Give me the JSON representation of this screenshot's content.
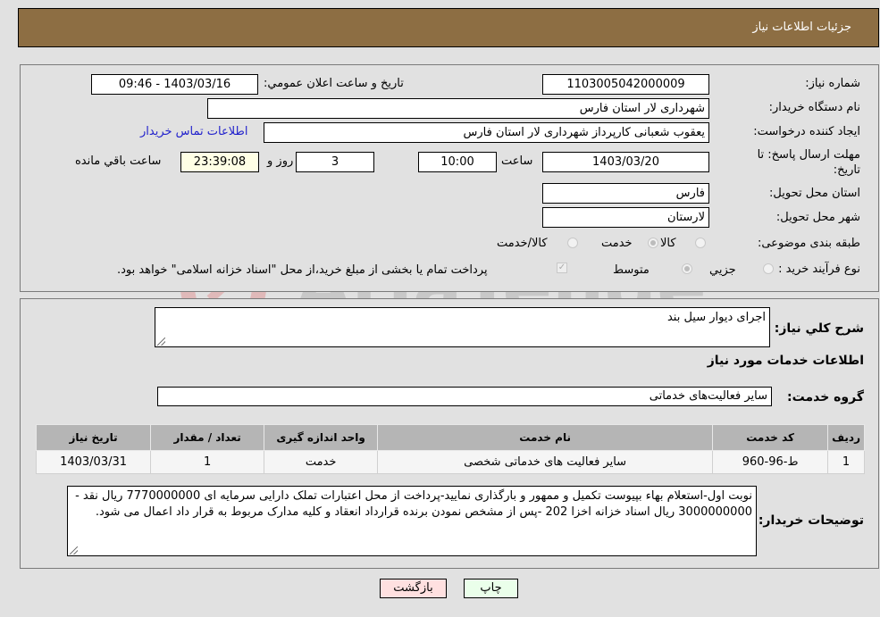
{
  "header": {
    "title": "جزئیات اطلاعات نیاز"
  },
  "form": {
    "need_number_label": "شماره نیاز:",
    "need_number": "1103005042000009",
    "announce_label": "تاریخ و ساعت اعلان عمومي:",
    "announce_value": "1403/03/16 - 09:46",
    "buyer_org_label": "نام دستگاه خریدار:",
    "buyer_org": "شهرداری لار استان فارس",
    "creator_label": "ایجاد کننده درخواست:",
    "creator": "یعقوب شعبانی کارپرداز شهرداری لار استان فارس",
    "contact_link": "اطلاعات تماس خریدار",
    "deadline_label": "مهلت ارسال پاسخ: تا تاریخ:",
    "deadline_date": "1403/03/20",
    "time_label": "ساعت",
    "deadline_time": "10:00",
    "days_value": "3",
    "days_label": "روز و",
    "remaining_time": "23:39:08",
    "remaining_label": "ساعت باقي مانده",
    "province_label": "استان محل تحویل:",
    "province": "فارس",
    "city_label": "شهر محل تحویل:",
    "city": "لارستان",
    "category_label": "طبقه بندی موضوعی:",
    "category_options": [
      {
        "label": "کالا",
        "selected": false
      },
      {
        "label": "خدمت",
        "selected": true
      },
      {
        "label": "کالا/خدمت",
        "selected": false
      }
    ],
    "purchase_type_label": "نوع فرآیند خرید :",
    "purchase_type_options": [
      {
        "label": "جزيي",
        "selected": false
      },
      {
        "label": "متوسط",
        "selected": true
      }
    ],
    "treasury_note": "پرداخت تمام یا بخشی از مبلغ خرید،از محل \"اسناد خزانه اسلامی\" خواهد بود.",
    "treasury_checked": true
  },
  "details": {
    "summary_label": "شرح كلي نياز:",
    "summary": "اجرای دیوار سیل بند",
    "services_heading": "اطلاعات خدمات مورد نیاز",
    "service_group_label": "گروه خدمت:",
    "service_group": "سایر فعالیت‌های خدماتی",
    "table": {
      "headers": [
        "ردیف",
        "کد خدمت",
        "نام خدمت",
        "واحد اندازه گیری",
        "تعداد / مقدار",
        "تاریخ نیاز"
      ],
      "rows": [
        [
          "1",
          "ط-96-960",
          "سایر فعالیت های خدماتی شخصی",
          "خدمت",
          "1",
          "1403/03/31"
        ]
      ]
    },
    "buyer_notes_label": "توضیحات خریدار:",
    "buyer_notes": "نوبت اول-استعلام بهاء بپیوست تکمیل و ممهور و بارگذاری نمایید-پرداخت از محل اعتبارات تملک دارایی سرمایه ای 7770000000 ریال نقد - 3000000000 ریال اسناد خزانه اخزا 202 -پس از مشخص نمودن برنده قرارداد انعقاد و کلیه مدارک مربوط به قرار داد  اعمال می شود."
  },
  "buttons": {
    "print": "چاپ",
    "back": "بازگشت"
  },
  "watermark": {
    "text": "AriaTender.neT"
  },
  "colors": {
    "header_bg": "#8d6e43",
    "print_bg": "#eaffea",
    "back_bg": "#ffe0e0",
    "link": "#2222cc"
  }
}
